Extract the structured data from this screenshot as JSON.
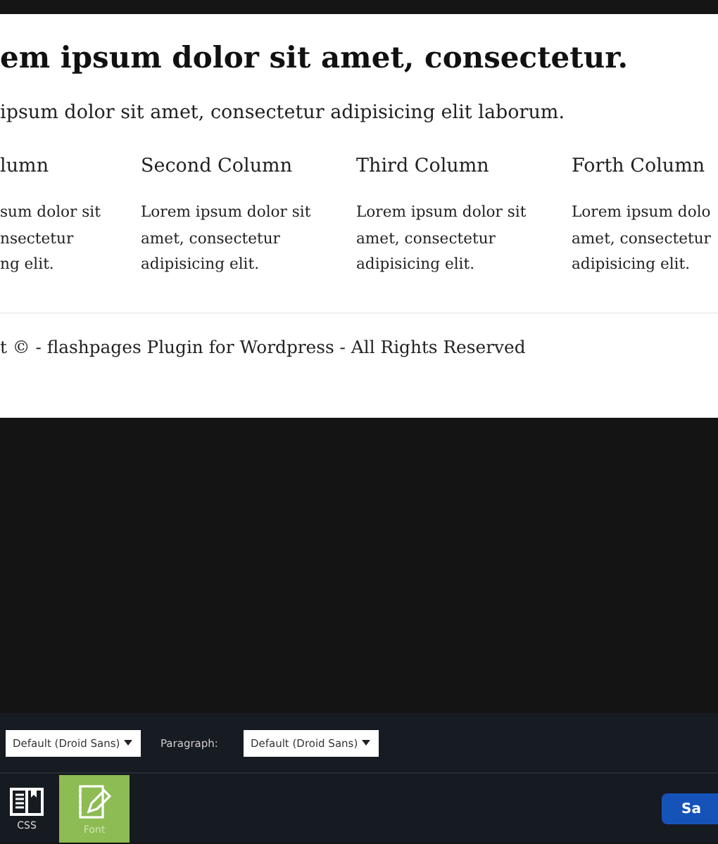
{
  "page": {
    "heading": "em ipsum dolor sit amet, consectetur.",
    "intro": "ipsum dolor sit amet, consectetur adipisicing elit laborum.",
    "columns": [
      {
        "title": "lumn",
        "text": "sum dolor sit\nnsectetur\nng elit."
      },
      {
        "title": "Second Column",
        "text": "Lorem ipsum dolor sit\namet, consectetur\nadipisicing elit."
      },
      {
        "title": "Third Column",
        "text": "Lorem ipsum dolor sit\namet, consectetur\nadipisicing elit."
      },
      {
        "title": "Forth Column",
        "text": "Lorem ipsum dolo\namet, consectetur\nadipisicing elit."
      }
    ],
    "footer": "t © - flashpages Plugin for Wordpress - All Rights Reserved"
  },
  "font_bar": {
    "heading_select": {
      "value": "Default (Droid Sans)"
    },
    "paragraph_label": "Paragraph:",
    "paragraph_select": {
      "value": "Default (Droid Sans)"
    }
  },
  "tabs": [
    {
      "kind": "css",
      "label": "CSS",
      "selected": false
    },
    {
      "kind": "font",
      "label": "Font",
      "selected": true
    }
  ],
  "save_button": "Sa"
}
